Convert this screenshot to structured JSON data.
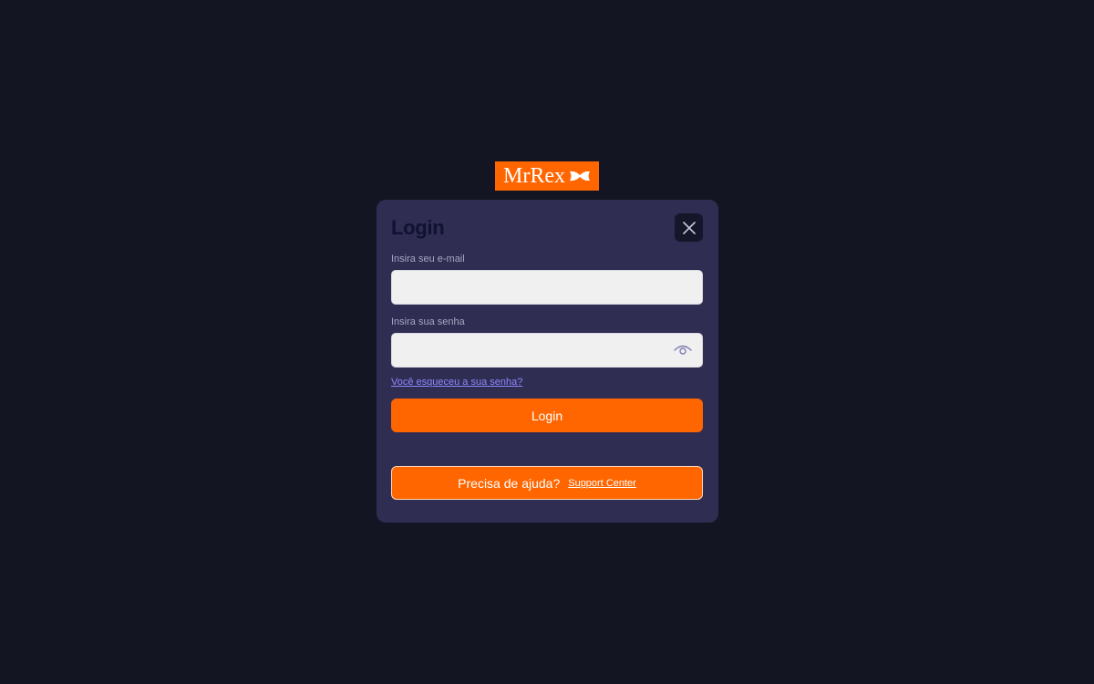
{
  "brand": {
    "logo_text": "MrRex",
    "color": "#ff6600"
  },
  "modal": {
    "title": "Login",
    "close_icon": "close-icon"
  },
  "email_field": {
    "label": "Insira seu e-mail",
    "value": "",
    "placeholder": ""
  },
  "password_field": {
    "label": "Insira sua senha",
    "value": "",
    "placeholder": "",
    "toggle_icon": "eye-icon"
  },
  "forgot_password": {
    "label": "Você esqueceu a sua senha?"
  },
  "login_button": {
    "label": "Login"
  },
  "help": {
    "text": "Precisa de ajuda?",
    "link_label": "Support Center"
  },
  "colors": {
    "background": "#141522",
    "modal": "#2f2d52",
    "accent": "#ff6600",
    "link": "#8f87ff"
  }
}
